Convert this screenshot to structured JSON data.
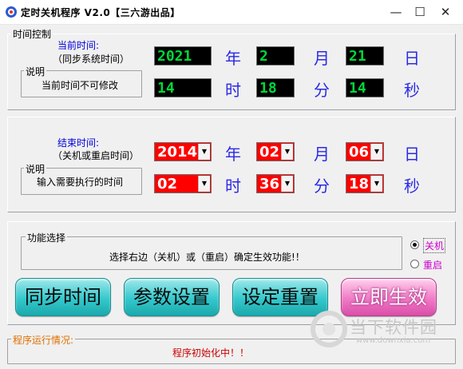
{
  "window": {
    "title": "定时关机程序 V2.0【三六游出品】",
    "minimize": "—",
    "maximize": "☐",
    "close": "✕"
  },
  "time_control": {
    "legend": "时间控制",
    "current_label": "当前时间:",
    "current_sub": "（同步系统时间）",
    "note_legend": "说明",
    "note_text": "当前时间不可修改",
    "year": "2021",
    "month": "2",
    "day": "21",
    "hour": "14",
    "minute": "18",
    "second": "14"
  },
  "end_time": {
    "label": "结束时间:",
    "sub": "（关机或重启时间）",
    "note_legend": "说明",
    "note_text": "输入需要执行的时间",
    "year": "2014",
    "month": "02",
    "day": "06",
    "hour": "02",
    "minute": "36",
    "second": "18"
  },
  "units": {
    "year": "年",
    "month": "月",
    "day": "日",
    "hour": "时",
    "minute": "分",
    "second": "秒"
  },
  "function": {
    "legend": "功能选择",
    "hint": "选择右边（关机）或（重启）确定生效功能!！",
    "shutdown": "关机",
    "restart": "重启",
    "selected": "shutdown"
  },
  "buttons": {
    "sync": "同步时间",
    "settings": "参数设置",
    "reset": "设定重置",
    "apply": "立即生效"
  },
  "status": {
    "legend": "程序运行情况:",
    "text": "程序初始化中！！"
  },
  "watermark": {
    "brand": "当下软件园",
    "url": "www.downxia.com"
  },
  "colors": {
    "lcd_bg": "#000000",
    "lcd_fg": "#00d83a",
    "combo_bg": "#ff0000",
    "button_teal": "#34c8cc",
    "button_pink": "#f07ac6"
  }
}
